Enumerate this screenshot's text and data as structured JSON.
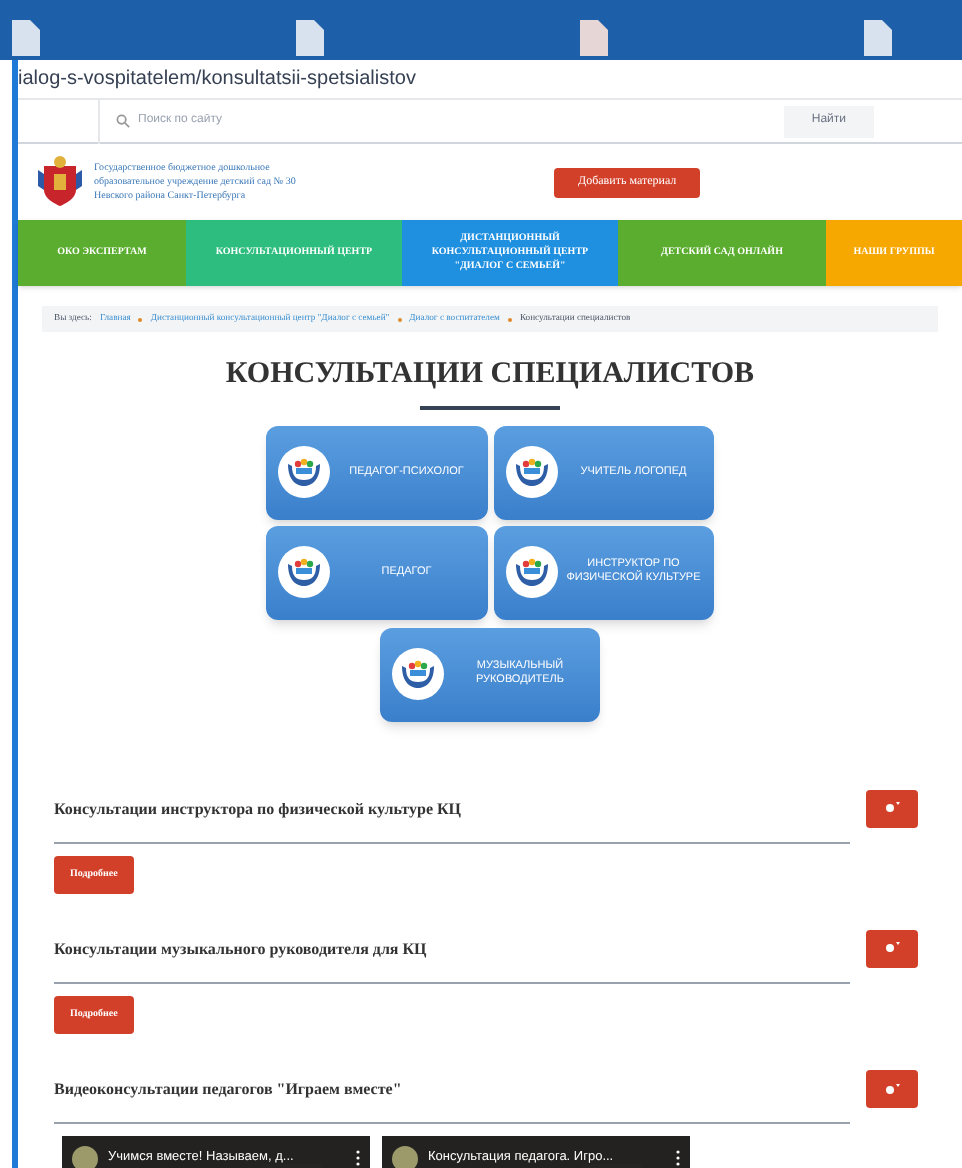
{
  "address_bar": {
    "url": "ialog-s-vospitatelem/konsultatsii-spetsialistov"
  },
  "search": {
    "placeholder": "Поиск по сайту",
    "button": "Найти"
  },
  "header": {
    "org_name": "Государственное бюджетное дошкольное образовательное учреждение детский сад № 30 Невского района Санкт-Петербурга",
    "add_button": "Добавить материал"
  },
  "nav": [
    {
      "label": "ОКО ЭКСПЕРТАМ",
      "color": "#5aad2e"
    },
    {
      "label": "КОНСУЛЬТАЦИОННЫЙ ЦЕНТР",
      "color": "#2dbd7e"
    },
    {
      "label": "ДИСТАНЦИОННЫЙ КОНСУЛЬТАЦИОННЫЙ ЦЕНТР \"ДИАЛОГ С СЕМЬЕЙ\"",
      "color": "#1f8fe0"
    },
    {
      "label": "ДЕТСКИЙ САД ОНЛАЙН",
      "color": "#5aad2e"
    },
    {
      "label": "НАШИ ГРУППЫ",
      "color": "#f6a800"
    }
  ],
  "breadcrumb": {
    "label": "Вы здесь:",
    "items": [
      "Главная",
      "Дистанционный консультационный центр \"Диалог с семьей\"",
      "Диалог с воспитателем",
      "Консультации специалистов"
    ]
  },
  "title": "КОНСУЛЬТАЦИИ СПЕЦИАЛИСТОВ",
  "specialists": [
    "ПЕДАГОГ-ПСИХОЛОГ",
    "УЧИТЕЛЬ ЛОГОПЕД",
    "ПЕДАГОГ",
    "ИНСТРУКТОР ПО ФИЗИЧЕСКОЙ КУЛЬТУРЕ",
    "МУЗЫКАЛЬНЫЙ РУКОВОДИТЕЛЬ"
  ],
  "sections": [
    {
      "title": "Консультации инструктора по физической культуре КЦ",
      "kind": "more",
      "button": "Подробнее"
    },
    {
      "title": "Консультации музыкального руководителя для КЦ",
      "kind": "more",
      "button": "Подробнее"
    },
    {
      "title": "Видеоконсультации педагогов \"Играем вместе\"",
      "kind": "videos",
      "videos": [
        "Учимся вместе! Называем, д...",
        "Консультация педагога. Игро..."
      ]
    }
  ]
}
